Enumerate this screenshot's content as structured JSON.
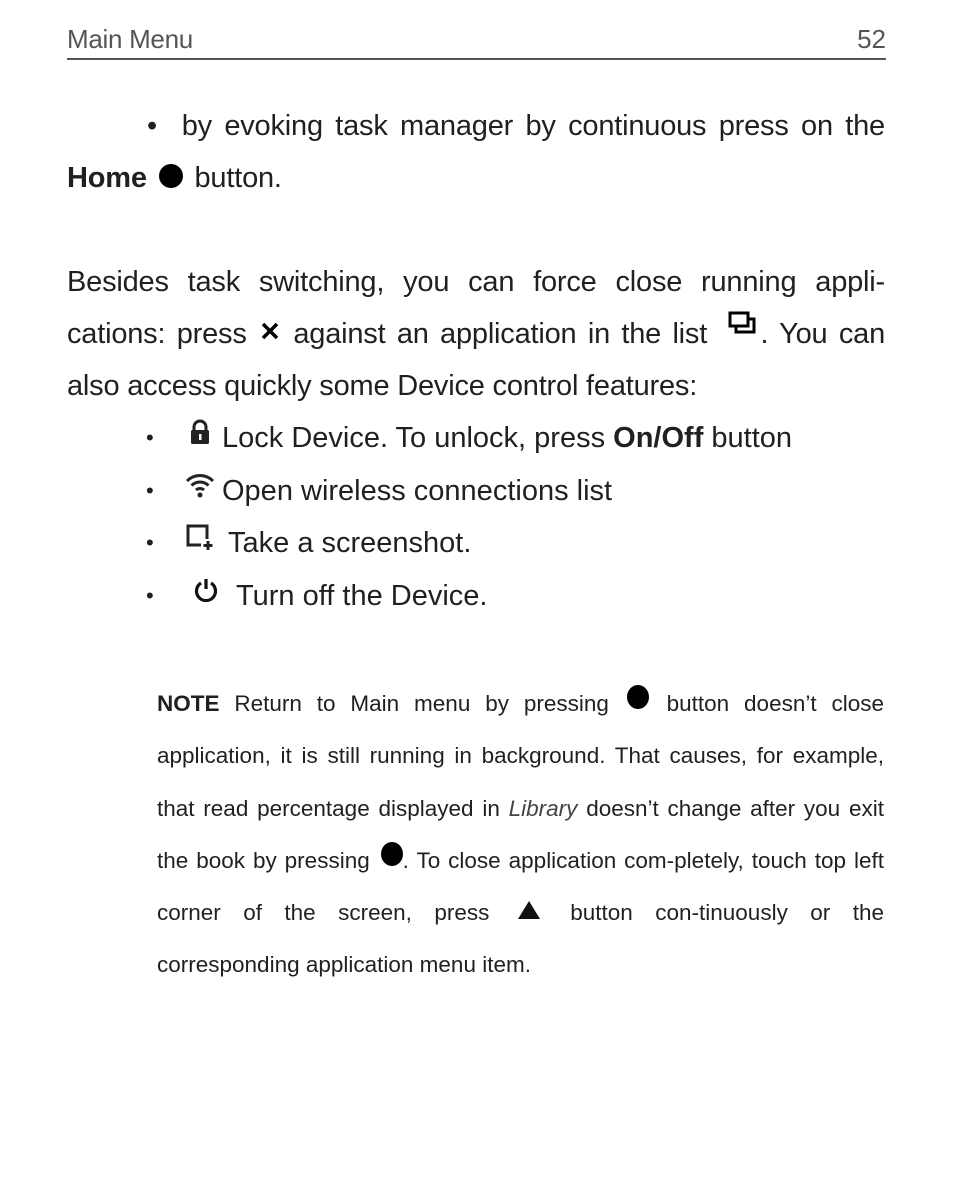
{
  "header": {
    "title": "Main Menu",
    "page_number": "52"
  },
  "intro": {
    "bullet_text": "by evoking task manager by continuous press on the",
    "bold": "Home",
    "icon": "home-dot-icon",
    "after": "button."
  },
  "paragraph": {
    "part1": "Besides task switching, you can force close running appli-cations: press",
    "icon_close": "close-x-icon",
    "part2": "against an application in the list",
    "icon_list": "task-list-icon",
    "part3": ". You can also access quickly some Device control features:"
  },
  "features": [
    {
      "icon": "lock-icon",
      "text_before": "Lock Device. To unlock, press",
      "bold": "On/Off",
      "text_after": "button"
    },
    {
      "icon": "wifi-icon",
      "text_before": "Open wireless connections list",
      "bold": "",
      "text_after": ""
    },
    {
      "icon": "screenshot-icon",
      "text_before": "Take a screenshot.",
      "bold": "",
      "text_after": ""
    },
    {
      "icon": "power-icon",
      "text_before": "Turn off the Device.",
      "bold": "",
      "text_after": ""
    }
  ],
  "note": {
    "label": "NOTE",
    "t1": "Return to Main menu by pressing",
    "t2": "button doesn’t close application, it is still running in background. That causes, for example, that read percentage displayed in",
    "italic": "Library",
    "t3": "doesn’t change after you exit the book by pressing",
    "t4": ". To close application com-pletely, touch top left corner of the screen, press",
    "t5": "button con-tinuously or the corresponding application menu item."
  },
  "bullet_char": "•"
}
